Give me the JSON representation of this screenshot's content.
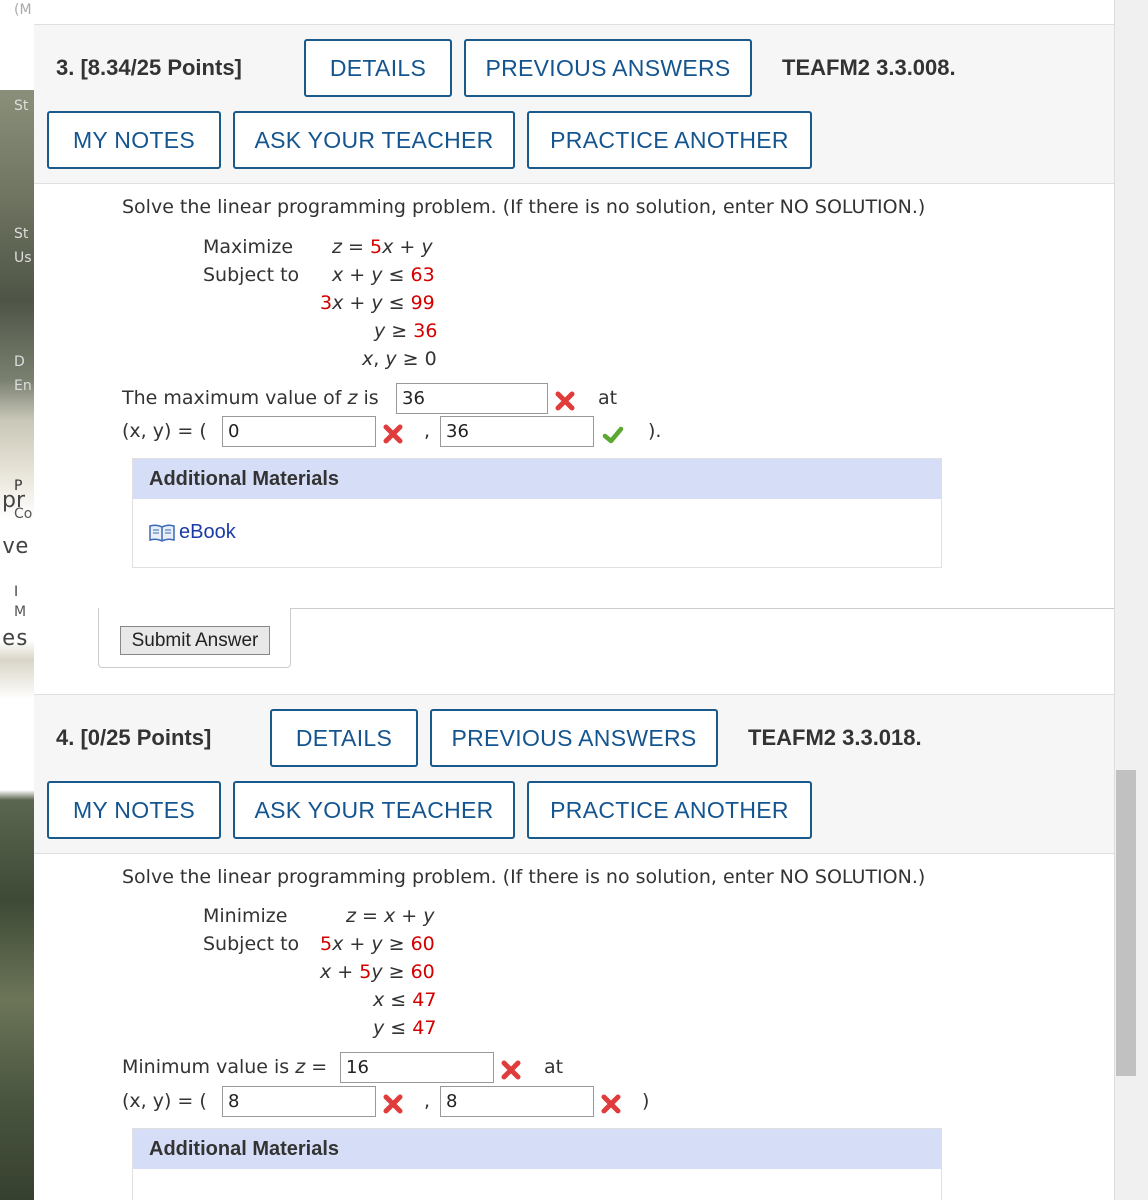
{
  "questions": [
    {
      "number": "3.",
      "points": "[8.34/25 Points]",
      "code": "TEAFM2 3.3.008.",
      "buttons": {
        "details": "DETAILS",
        "previous_answers": "PREVIOUS ANSWERS",
        "my_notes": "MY NOTES",
        "ask_teacher": "ASK YOUR TEACHER",
        "practice_another": "PRACTICE ANOTHER"
      },
      "prompt": "Solve the linear programming problem. (If there is no solution, enter NO SOLUTION.)",
      "objective_label": "Maximize",
      "subject_label": "Subject to",
      "answer_label": "The maximum value of",
      "answer_z": "z",
      "answer_is": "is",
      "at": "at",
      "xy_label": "(x, y) = (",
      "close": ").",
      "answers": {
        "value": "36",
        "x": "0",
        "y": "36"
      },
      "marks": {
        "value": "incorrect",
        "x": "incorrect",
        "y": "correct"
      }
    },
    {
      "number": "4.",
      "points": "[0/25 Points]",
      "code": "TEAFM2 3.3.018.",
      "buttons": {
        "details": "DETAILS",
        "previous_answers": "PREVIOUS ANSWERS",
        "my_notes": "MY NOTES",
        "ask_teacher": "ASK YOUR TEACHER",
        "practice_another": "PRACTICE ANOTHER"
      },
      "prompt": "Solve the linear programming problem. (If there is no solution, enter NO SOLUTION.)",
      "objective_label": "Minimize",
      "subject_label": "Subject to",
      "answer_label": "Minimum value is",
      "answer_z": "z",
      "answer_is": "=",
      "at": "at",
      "xy_label": "(x, y) = (",
      "close": ")",
      "answers": {
        "value": "16",
        "x": "8",
        "y": "8"
      },
      "marks": {
        "value": "incorrect",
        "x": "incorrect",
        "y": "incorrect"
      }
    }
  ],
  "additional_materials": {
    "heading": "Additional Materials",
    "ebook": "eBook",
    "icon": "book-icon"
  },
  "submit": {
    "label": "Submit Answer"
  },
  "background_fragments": [
    "(M",
    "St",
    "St",
    "Us",
    "D",
    "En",
    "P",
    "pr",
    "Co",
    "ve",
    "I",
    "M",
    "es"
  ],
  "colors": {
    "link_blue": "#14558f",
    "coefficient_red": "#d40000",
    "header_bg": "#f6f6f6",
    "materials_bg": "#d6def7",
    "correct_green": "#5aa832",
    "incorrect_red": "#e03c3c"
  }
}
